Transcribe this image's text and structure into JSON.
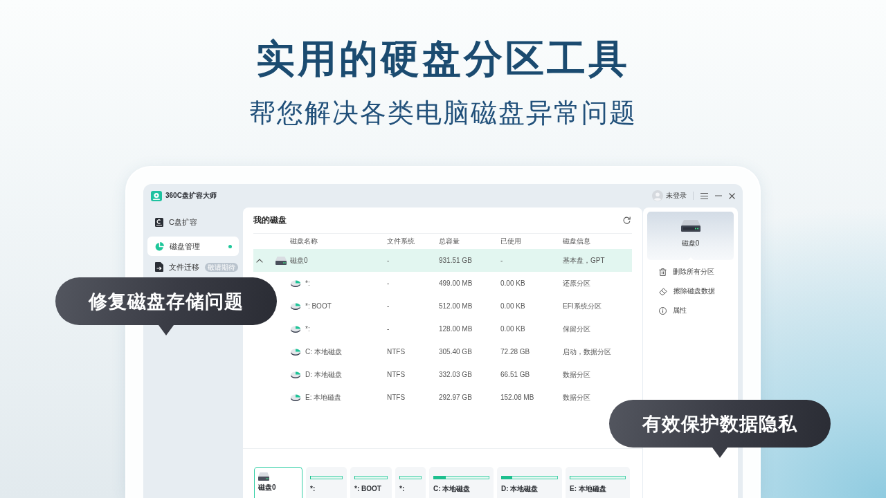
{
  "headline": {
    "title": "实用的硬盘分区工具",
    "subtitle": "帮您解决各类电脑磁盘异常问题"
  },
  "window": {
    "title": "360C盘扩容大师",
    "user": "未登录"
  },
  "sidebar": {
    "items": [
      {
        "label": "C盘扩容",
        "selected": false
      },
      {
        "label": "磁盘管理",
        "selected": true
      },
      {
        "label": "文件迁移",
        "selected": false,
        "badge": "敬请期待"
      }
    ]
  },
  "disks": {
    "title": "我的磁盘",
    "columns": [
      "磁盘名称",
      "文件系统",
      "总容量",
      "已使用",
      "磁盘信息"
    ],
    "rows": [
      {
        "name": "磁盘0",
        "file_system": "-",
        "capacity": "931.51 GB",
        "used": "-",
        "info": "基本盘，GPT",
        "selected": true,
        "expanded": true,
        "children": [
          {
            "name": "*:",
            "file_system": "-",
            "capacity": "499.00 MB",
            "used": "0.00 KB",
            "info": "还原分区",
            "selected": false
          },
          {
            "name": "*: BOOT",
            "file_system": "-",
            "capacity": "512.00 MB",
            "used": "0.00 KB",
            "info": "EFI系统分区",
            "selected": false
          },
          {
            "name": "*:",
            "file_system": "-",
            "capacity": "128.00 MB",
            "used": "0.00 KB",
            "info": "保留分区",
            "selected": false
          },
          {
            "name": "C: 本地磁盘",
            "file_system": "NTFS",
            "capacity": "305.40 GB",
            "used": "72.28 GB",
            "info": "启动，数据分区",
            "selected": false
          },
          {
            "name": "D: 本地磁盘",
            "file_system": "NTFS",
            "capacity": "332.03 GB",
            "used": "66.51 GB",
            "info": "数据分区",
            "selected": false
          },
          {
            "name": "E: 本地磁盘",
            "file_system": "NTFS",
            "capacity": "292.97 GB",
            "used": "152.08 MB",
            "info": "数据分区",
            "selected": false
          }
        ]
      }
    ]
  },
  "disk_map": {
    "cards": [
      {
        "kind": "disk",
        "name": "磁盘0",
        "selected": true
      },
      {
        "kind": "partition",
        "name": "*:",
        "level": 0,
        "selected": false
      },
      {
        "kind": "partition",
        "name": "*: BOOT",
        "level": 0,
        "selected": false
      },
      {
        "kind": "partition",
        "name": "*:",
        "level": 0,
        "selected": false
      },
      {
        "kind": "partition",
        "name": "C: 本地磁盘",
        "level": 0.22,
        "selected": false
      },
      {
        "kind": "partition",
        "name": "D: 本地磁盘",
        "level": 0.19,
        "selected": false
      },
      {
        "kind": "partition",
        "name": "E: 本地磁盘",
        "level": 0,
        "selected": false
      }
    ]
  },
  "details": {
    "name": "磁盘0",
    "actions": [
      "删除所有分区",
      "擦除磁盘数据",
      "属性"
    ]
  },
  "callouts": [
    "修复磁盘存储问题",
    "有效保护数据隐私"
  ]
}
